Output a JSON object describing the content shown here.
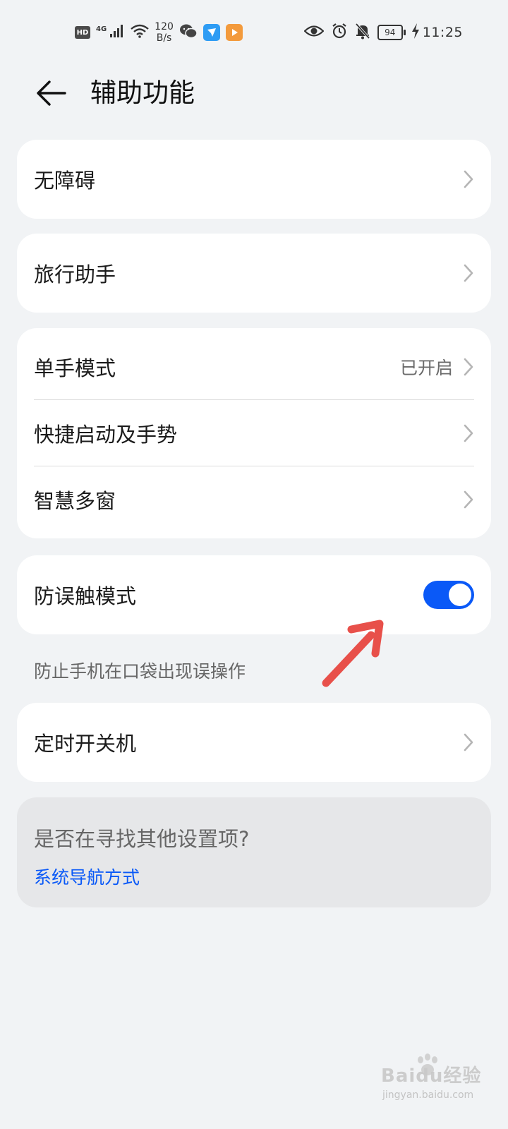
{
  "status_bar": {
    "hd": "HD",
    "network": "4G",
    "speed_value": "120",
    "speed_unit": "B/s",
    "battery": "94",
    "time": "11:25"
  },
  "header": {
    "title": "辅助功能"
  },
  "cards": {
    "accessibility": {
      "label": "无障碍"
    },
    "travel": {
      "label": "旅行助手"
    },
    "group": {
      "one_hand": {
        "label": "单手模式",
        "value": "已开启"
      },
      "shortcuts": {
        "label": "快捷启动及手势"
      },
      "multi_window": {
        "label": "智慧多窗"
      }
    },
    "pocket_mode": {
      "label": "防误触模式",
      "enabled": true,
      "caption": "防止手机在口袋出现误操作"
    },
    "schedule_power": {
      "label": "定时开关机"
    },
    "suggest": {
      "title": "是否在寻找其他设置项?",
      "link": "系统导航方式"
    }
  },
  "watermark": {
    "brand": "Baidu经验",
    "sub": "jingyan.baidu.com"
  },
  "colors": {
    "background": "#F1F3F5",
    "card": "#FFFFFF",
    "accent": "#0A59F7",
    "arrow": "#E8504A"
  }
}
